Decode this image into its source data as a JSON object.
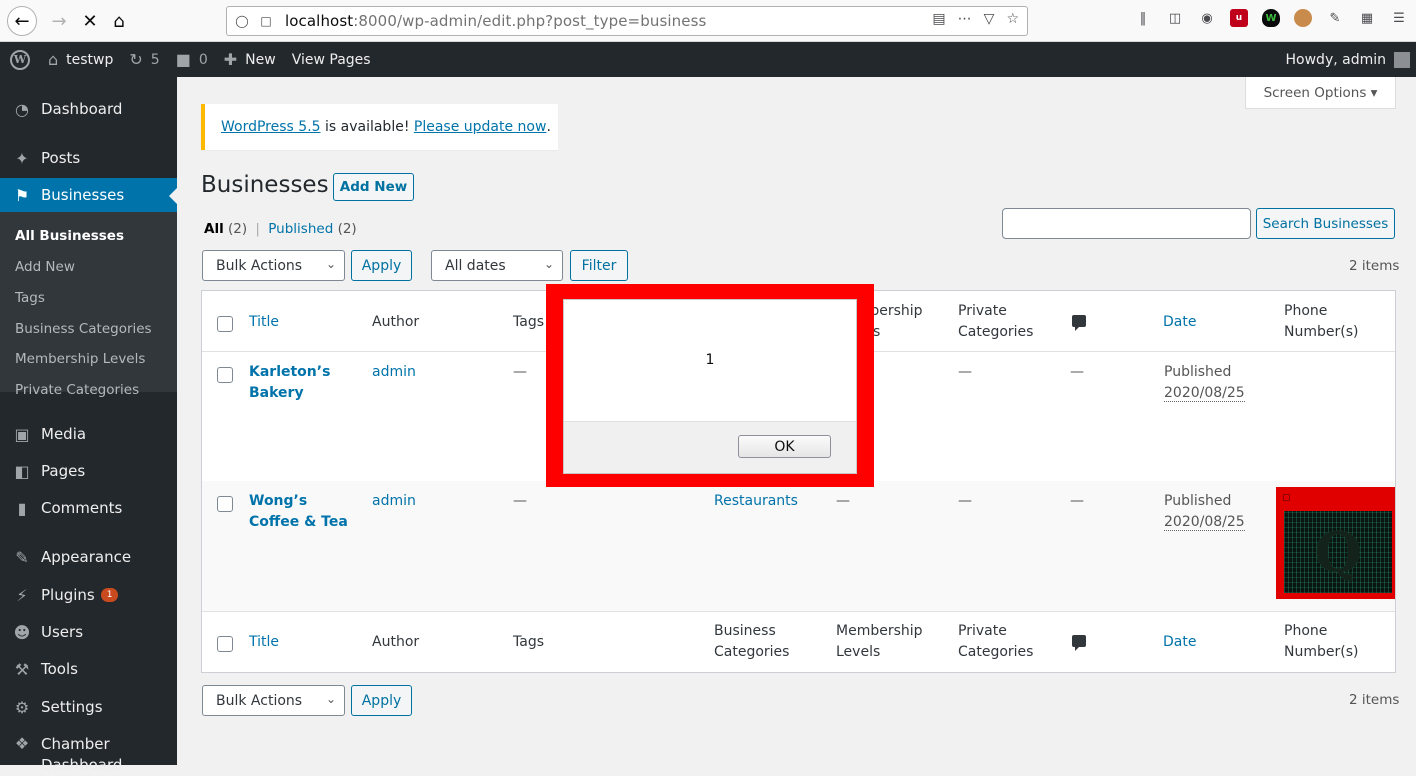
{
  "browser": {
    "url_host": "localhost",
    "url_rest": ":8000/wp-admin/edit.php?post_type=business"
  },
  "adminbar": {
    "site_name": "testwp",
    "updates_count": "5",
    "comments_count": "0",
    "new_label": "New",
    "view_pages_label": "View Pages",
    "howdy": "Howdy, admin"
  },
  "sidebar": {
    "dashboard": "Dashboard",
    "posts": "Posts",
    "businesses": "Businesses",
    "sub": {
      "all": "All Businesses",
      "add_new": "Add New",
      "tags": "Tags",
      "business_categories": "Business Categories",
      "membership_levels": "Membership Levels",
      "private_categories": "Private Categories"
    },
    "media": "Media",
    "pages": "Pages",
    "comments": "Comments",
    "appearance": "Appearance",
    "plugins": "Plugins",
    "plugins_badge": "1",
    "users": "Users",
    "tools": "Tools",
    "settings": "Settings",
    "chamber_line1": "Chamber",
    "chamber_line2": "Dashboard"
  },
  "screen_options": "Screen Options",
  "notice": {
    "link1": "WordPress 5.5",
    "middle": " is available! ",
    "link2": "Please update now",
    "end": "."
  },
  "page": {
    "title": "Businesses",
    "add_new": "Add New",
    "filter_all": "All",
    "filter_all_count": "(2)",
    "filter_sep": "|",
    "filter_published": "Published",
    "filter_published_count": "(2)",
    "search_button": "Search Businesses",
    "bulk_actions": "Bulk Actions",
    "apply": "Apply",
    "all_dates": "All dates",
    "filter": "Filter",
    "items_count": "2 items"
  },
  "table": {
    "headers": {
      "title": "Title",
      "author": "Author",
      "tags": "Tags",
      "business_categories_1": "Business",
      "business_categories_2": "Categories",
      "membership_1": "Membership",
      "membership_2": "Levels",
      "private_1": "Private",
      "private_2": "Categories",
      "date": "Date",
      "phone_1": "Phone",
      "phone_2": "Number(s)"
    },
    "rows": [
      {
        "title_1": "Karleton’s",
        "title_2": "Bakery",
        "author": "admin",
        "tags": "—",
        "business_categories": "",
        "membership": "—",
        "private": "—",
        "comments": "—",
        "date_status": "Published",
        "date_value": "2020/08/25"
      },
      {
        "title_1": "Wong’s",
        "title_2": "Coffee & Tea",
        "author": "admin",
        "tags": "—",
        "business_categories": "Restaurants",
        "membership": "—",
        "private": "—",
        "comments": "—",
        "date_status": "Published",
        "date_value": "2020/08/25"
      }
    ]
  },
  "alert": {
    "message": "1",
    "ok": "OK"
  },
  "colors": {
    "wp_dark": "#23282d",
    "wp_blue": "#0073aa",
    "alert_frame": "#ff0000"
  }
}
